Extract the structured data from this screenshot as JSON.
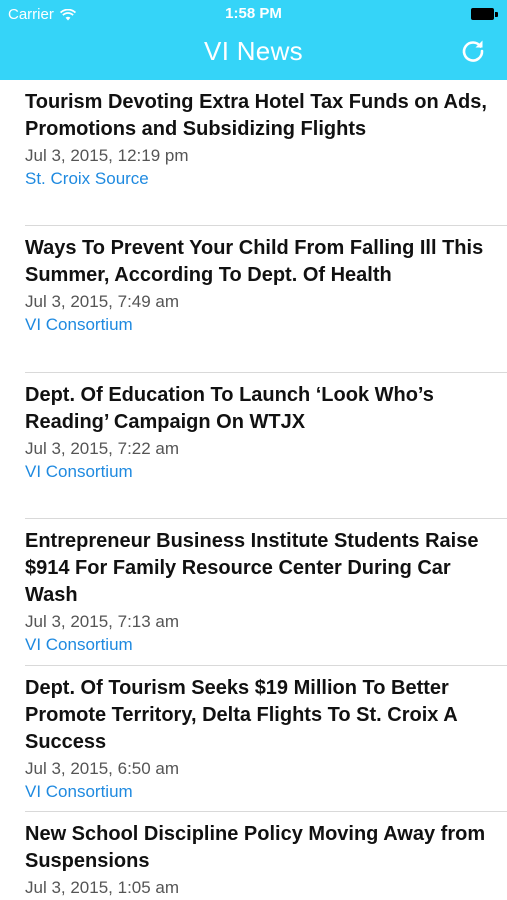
{
  "status_bar": {
    "carrier": "Carrier",
    "time": "1:58 PM"
  },
  "nav": {
    "title": "VI News",
    "refresh_icon": "refresh-icon"
  },
  "colors": {
    "header_bg": "#35d4f8",
    "source_link": "#1f8ae0"
  },
  "articles": [
    {
      "title": "Tourism Devoting Extra Hotel Tax Funds on Ads, Promotions and Subsidizing Flights",
      "date": "Jul 3, 2015, 12:19 pm",
      "source": "St. Croix Source"
    },
    {
      "title": "Ways To Prevent Your Child From Falling Ill This Summer, According To Dept. Of Health",
      "date": "Jul 3, 2015, 7:49 am",
      "source": "VI Consortium"
    },
    {
      "title": "Dept. Of Education To Launch ‘Look Who’s Reading’ Campaign On WTJX",
      "date": "Jul 3, 2015, 7:22 am",
      "source": "VI Consortium"
    },
    {
      "title": "Entrepreneur Business Institute Students Raise $914 For Family Resource Center During Car Wash",
      "date": "Jul 3, 2015, 7:13 am",
      "source": "VI Consortium"
    },
    {
      "title": "Dept. Of Tourism Seeks $19 Million To Better Promote Territory, Delta Flights To St. Croix A Success",
      "date": "Jul 3, 2015, 6:50 am",
      "source": "VI Consortium"
    },
    {
      "title": "New School Discipline Policy Moving Away from Suspensions",
      "date": "Jul 3, 2015, 1:05 am",
      "source": ""
    }
  ]
}
